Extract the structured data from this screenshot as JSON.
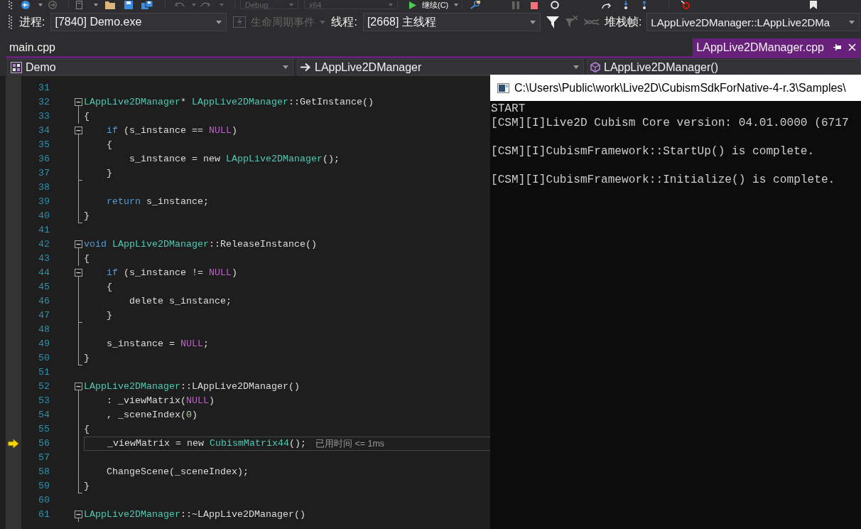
{
  "standard_toolbar": {
    "configuration": {
      "label": "Debug",
      "disabled": true
    },
    "platform": {
      "label": "x64",
      "disabled": true
    },
    "continue_button": {
      "label": "继续(C)"
    }
  },
  "debug_location_toolbar": {
    "process_label": "进程:",
    "process_value": "[7840] Demo.exe",
    "lifecycle_events": {
      "label": "生命周期事件",
      "disabled": true
    },
    "thread_label": "线程:",
    "thread_value": "[2668] 主线程",
    "thread_filters": [
      {
        "kind": "filter",
        "disabled": false
      },
      {
        "kind": "clear-filter",
        "disabled": true
      },
      {
        "kind": "threads",
        "disabled": true
      }
    ],
    "stack_frame_label": "堆栈帧:",
    "stack_frame_value": "LAppLive2DManager::LAppLive2DMa"
  },
  "document_tabs": [
    {
      "label": "main.cpp",
      "kind": "regular",
      "selected": false
    },
    {
      "label": "LAppLive2DManager.cpp",
      "kind": "preview",
      "selected": true
    }
  ],
  "navigation_bar": {
    "project": "Demo",
    "scope": "LAppLive2DManager",
    "member": "LAppLive2DManager()"
  },
  "editor": {
    "lines": [
      {
        "number": "31",
        "kind": "plain",
        "current": false
      },
      {
        "number": "32",
        "kind": "head",
        "current": false,
        "tokens": [
          {
            "kind": "type",
            "text": "LAppLive2DManager"
          },
          {
            "kind": "plain",
            "text": "* "
          },
          {
            "kind": "type",
            "text": "LAppLive2DManager"
          },
          {
            "kind": "plain",
            "text": "::GetInstance()"
          }
        ]
      },
      {
        "number": "33",
        "kind": "body",
        "current": false,
        "tokens": [
          {
            "kind": "plain",
            "text": "{"
          }
        ]
      },
      {
        "number": "34",
        "kind": "head",
        "current": false,
        "tokens": [
          {
            "kind": "keyword",
            "text": "    if"
          },
          {
            "kind": "plain",
            "text": " (s_instance == "
          },
          {
            "kind": "macro",
            "text": "NULL"
          },
          {
            "kind": "plain",
            "text": ")"
          }
        ]
      },
      {
        "number": "35",
        "kind": "body",
        "current": false,
        "tokens": [
          {
            "kind": "plain",
            "text": "    {"
          }
        ]
      },
      {
        "number": "36",
        "kind": "body",
        "current": false,
        "tokens": [
          {
            "kind": "plain",
            "text": "        s_instance = new "
          },
          {
            "kind": "type",
            "text": "LAppLive2DManager"
          },
          {
            "kind": "plain",
            "text": "();"
          }
        ]
      },
      {
        "number": "37",
        "kind": "tail",
        "current": false,
        "tokens": [
          {
            "kind": "plain",
            "text": "    }"
          }
        ]
      },
      {
        "number": "38",
        "kind": "body",
        "current": false
      },
      {
        "number": "39",
        "kind": "body",
        "current": false,
        "tokens": [
          {
            "kind": "keyword",
            "text": "    return"
          },
          {
            "kind": "plain",
            "text": " s_instance;"
          }
        ]
      },
      {
        "number": "40",
        "kind": "tail",
        "current": false,
        "tokens": [
          {
            "kind": "plain",
            "text": "}"
          }
        ]
      },
      {
        "number": "41",
        "kind": "plain",
        "current": false
      },
      {
        "number": "42",
        "kind": "head",
        "current": false,
        "tokens": [
          {
            "kind": "keyword",
            "text": "void"
          },
          {
            "kind": "type",
            "text": " LAppLive2DManager"
          },
          {
            "kind": "plain",
            "text": "::ReleaseInstance()"
          }
        ]
      },
      {
        "number": "43",
        "kind": "body",
        "current": false,
        "tokens": [
          {
            "kind": "plain",
            "text": "{"
          }
        ]
      },
      {
        "number": "44",
        "kind": "head",
        "current": false,
        "tokens": [
          {
            "kind": "keyword",
            "text": "    if"
          },
          {
            "kind": "plain",
            "text": " (s_instance != "
          },
          {
            "kind": "macro",
            "text": "NULL"
          },
          {
            "kind": "plain",
            "text": ")"
          }
        ]
      },
      {
        "number": "45",
        "kind": "body",
        "current": false,
        "tokens": [
          {
            "kind": "plain",
            "text": "    {"
          }
        ]
      },
      {
        "number": "46",
        "kind": "body",
        "current": false,
        "tokens": [
          {
            "kind": "plain",
            "text": "        delete s_instance;"
          }
        ]
      },
      {
        "number": "47",
        "kind": "tail",
        "current": false,
        "tokens": [
          {
            "kind": "plain",
            "text": "    }"
          }
        ]
      },
      {
        "number": "48",
        "kind": "body",
        "current": false
      },
      {
        "number": "49",
        "kind": "body",
        "current": false,
        "tokens": [
          {
            "kind": "plain",
            "text": "    s_instance = "
          },
          {
            "kind": "macro",
            "text": "NULL"
          },
          {
            "kind": "plain",
            "text": ";"
          }
        ]
      },
      {
        "number": "50",
        "kind": "tail",
        "current": false,
        "tokens": [
          {
            "kind": "plain",
            "text": "}"
          }
        ]
      },
      {
        "number": "51",
        "kind": "plain",
        "current": false
      },
      {
        "number": "52",
        "kind": "head",
        "current": false,
        "tokens": [
          {
            "kind": "type",
            "text": "LAppLive2DManager"
          },
          {
            "kind": "plain",
            "text": "::LAppLive2DManager()"
          }
        ]
      },
      {
        "number": "53",
        "kind": "body",
        "current": false,
        "tokens": [
          {
            "kind": "plain",
            "text": "    : _viewMatrix("
          },
          {
            "kind": "macro",
            "text": "NULL"
          },
          {
            "kind": "plain",
            "text": ")"
          }
        ]
      },
      {
        "number": "54",
        "kind": "body",
        "current": false,
        "tokens": [
          {
            "kind": "plain",
            "text": "    , _sceneIndex("
          },
          {
            "kind": "number",
            "text": "0"
          },
          {
            "kind": "plain",
            "text": ")"
          }
        ]
      },
      {
        "number": "55",
        "kind": "body",
        "current": false,
        "tokens": [
          {
            "kind": "plain",
            "text": "{"
          }
        ]
      },
      {
        "number": "56",
        "kind": "body",
        "current": true,
        "hint": "已用时间 <= 1ms",
        "tokens": [
          {
            "kind": "plain",
            "text": "    _viewMatrix = new "
          },
          {
            "kind": "type",
            "text": "CubismMatrix44"
          },
          {
            "kind": "plain",
            "text": "();"
          }
        ]
      },
      {
        "number": "57",
        "kind": "body",
        "current": false
      },
      {
        "number": "58",
        "kind": "body",
        "current": false,
        "tokens": [
          {
            "kind": "plain",
            "text": "    ChangeScene(_sceneIndex);"
          }
        ]
      },
      {
        "number": "59",
        "kind": "tail",
        "current": false,
        "tokens": [
          {
            "kind": "plain",
            "text": "}"
          }
        ]
      },
      {
        "number": "60",
        "kind": "plain",
        "current": false
      },
      {
        "number": "61",
        "kind": "head",
        "current": false,
        "tokens": [
          {
            "kind": "type",
            "text": "LAppLive2DManager"
          },
          {
            "kind": "plain",
            "text": "::~LAppLive2DManager()"
          }
        ]
      }
    ]
  },
  "console_window": {
    "title": "C:\\Users\\Public\\work\\Live2D\\CubismSdkForNative-4-r.3\\Samples\\",
    "output_blocks": [
      [
        "START",
        "[CSM][I]Live2D Cubism Core version: 04.01.0000 (6717"
      ],
      [
        "[CSM][I]CubismFramework::StartUp() is complete."
      ],
      [
        "[CSM][I]CubismFramework::Initialize() is complete."
      ]
    ]
  }
}
